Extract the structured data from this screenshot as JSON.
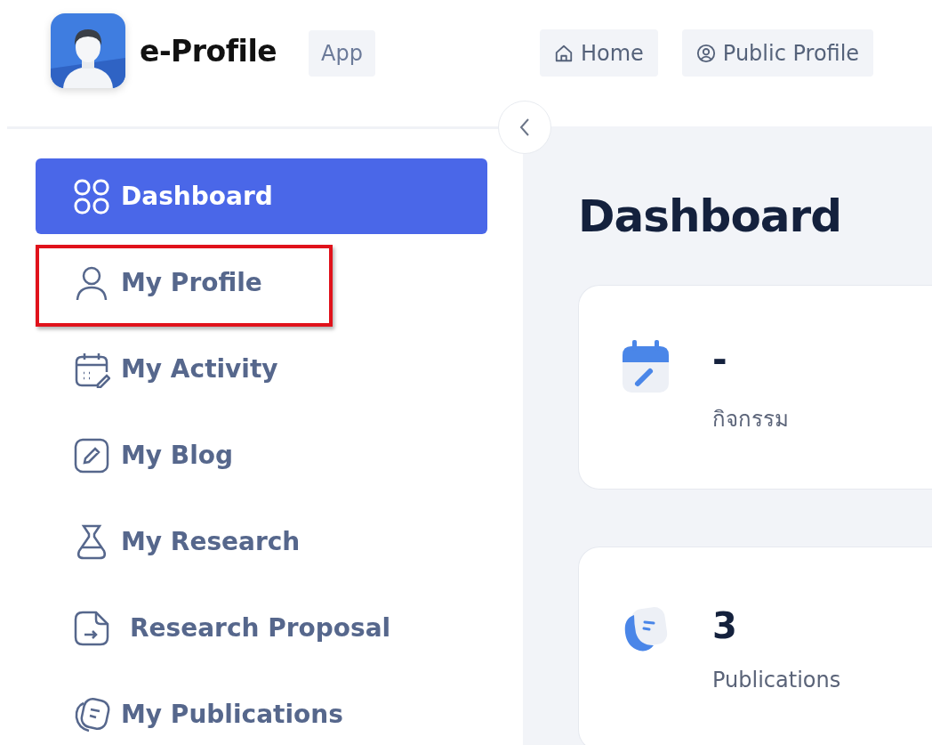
{
  "header": {
    "app_name": "e-Profile",
    "badge": "App",
    "nav": [
      {
        "label": "Home"
      },
      {
        "label": "Public Profile"
      }
    ]
  },
  "sidebar": {
    "items": [
      {
        "label": "Dashboard",
        "selected": true,
        "highlighted": false
      },
      {
        "label": "My Profile",
        "selected": false,
        "highlighted": true
      },
      {
        "label": "My Activity",
        "selected": false,
        "highlighted": false
      },
      {
        "label": "My Blog",
        "selected": false,
        "highlighted": false
      },
      {
        "label": "My Research",
        "selected": false,
        "highlighted": false
      },
      {
        "label": "Research Proposal",
        "selected": false,
        "highlighted": false
      },
      {
        "label": "My Publications",
        "selected": false,
        "highlighted": false
      }
    ]
  },
  "main": {
    "title": "Dashboard",
    "cards": [
      {
        "value": "-",
        "label": "กิจกรรม"
      },
      {
        "value": "3",
        "label": "Publications"
      }
    ]
  }
}
